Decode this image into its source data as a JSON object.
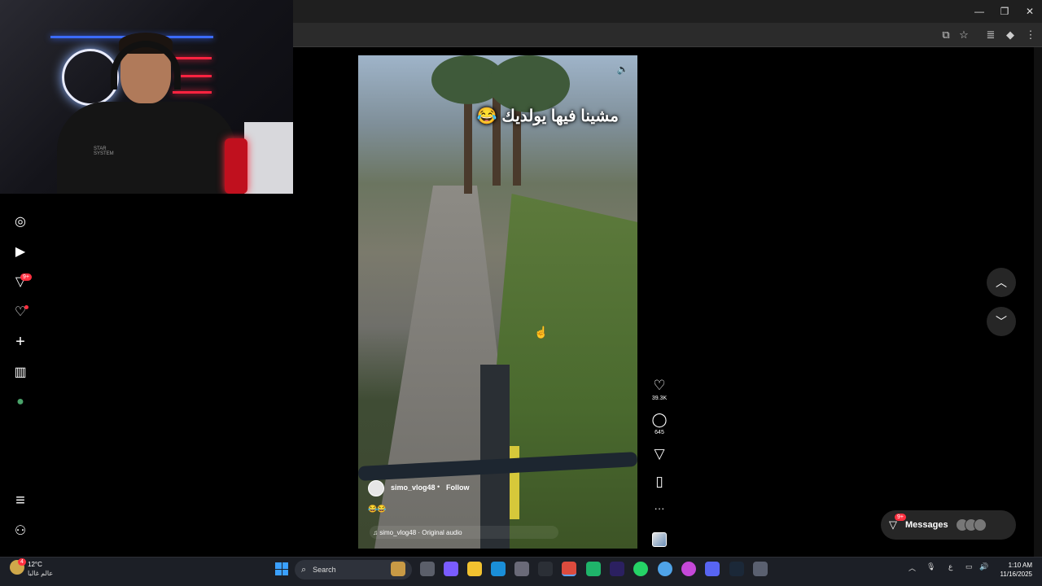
{
  "browser": {
    "window_controls": {
      "minimize": "—",
      "restore": "❐",
      "close": "✕"
    }
  },
  "webcam": {
    "shirt_text": "STAR\nSYSTEM"
  },
  "sidebar": {
    "items": [
      {
        "name": "explore",
        "icon": "compass-icon",
        "glyph": "◎"
      },
      {
        "name": "reels",
        "icon": "reels-icon",
        "glyph": "▶"
      },
      {
        "name": "messages",
        "icon": "send-icon",
        "glyph": "▽",
        "badge": "9+"
      },
      {
        "name": "notifications",
        "icon": "heart-icon",
        "glyph": "♡"
      },
      {
        "name": "create",
        "icon": "plus-icon",
        "glyph": "+"
      },
      {
        "name": "dashboard",
        "icon": "chart-icon",
        "glyph": "▥"
      },
      {
        "name": "profile",
        "icon": "avatar-icon",
        "glyph": "●"
      },
      {
        "name": "more",
        "icon": "menu-icon",
        "glyph": "≡"
      },
      {
        "name": "also-from-meta",
        "icon": "meta-icon",
        "glyph": "⚇"
      }
    ]
  },
  "reel": {
    "caption": "مشينا فيها يولديك 😂",
    "username": "simo_vlog48",
    "separator": "•",
    "follow_label": "Follow",
    "description": "😂😂",
    "audio": "♫ simo_vlog48 · Original audio",
    "mute_glyph": "🔈"
  },
  "actions": {
    "likes": "39.3K",
    "comments": "645",
    "like_glyph": "♡",
    "comment_glyph": "◯",
    "share_glyph": "▽",
    "save_glyph": "▯",
    "more_glyph": "···"
  },
  "navigation": {
    "up_glyph": "︿",
    "down_glyph": "﹀"
  },
  "messages": {
    "label": "Messages",
    "badge": "9+"
  },
  "taskbar": {
    "temperature": "12°C",
    "city": "عالم غالبا",
    "search_placeholder": "Search",
    "tray_lang": "ع",
    "time": "1:10 AM",
    "date": "11/16/2025",
    "notif_badge": "4"
  }
}
